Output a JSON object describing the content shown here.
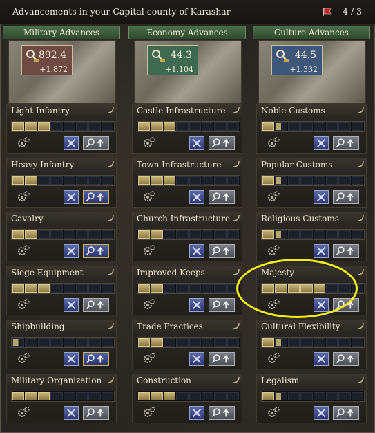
{
  "window": {
    "title": "Advancements in your Capital county of Karashar",
    "counter": "4 / 3"
  },
  "columns": [
    {
      "header": "Military Advances",
      "total": "892.4",
      "rate": "+1.872",
      "panel_color": "#6e4a45",
      "items": [
        {
          "name": "Light Infantry",
          "full": 3,
          "partial": 0
        },
        {
          "name": "Heavy Infantry",
          "full": 2,
          "partial": 0
        },
        {
          "name": "Cavalry",
          "full": 2,
          "partial": 0
        },
        {
          "name": "Siege Equipment",
          "full": 3,
          "partial": 0
        },
        {
          "name": "Shipbuilding",
          "full": 0,
          "partial": 1
        },
        {
          "name": "Military Organization",
          "full": 3,
          "partial": 0
        }
      ]
    },
    {
      "header": "Economy Advances",
      "total": "44.3",
      "rate": "+1.104",
      "panel_color": "#3f6a52",
      "items": [
        {
          "name": "Castle Infrastructure",
          "full": 3,
          "partial": 0
        },
        {
          "name": "Town Infrastructure",
          "full": 3,
          "partial": 0
        },
        {
          "name": "Church Infrastructure",
          "full": 2,
          "partial": 0
        },
        {
          "name": "Improved Keeps",
          "full": 2,
          "partial": 0
        },
        {
          "name": "Trade Practices",
          "full": 2,
          "partial": 0
        },
        {
          "name": "Construction",
          "full": 3,
          "partial": 0
        }
      ]
    },
    {
      "header": "Culture Advances",
      "total": "44.5",
      "rate": "+1.332",
      "panel_color": "#3d567a",
      "items": [
        {
          "name": "Noble Customs",
          "full": 1,
          "partial": 1
        },
        {
          "name": "Popular Customs",
          "full": 1,
          "partial": 1
        },
        {
          "name": "Religious Customs",
          "full": 1,
          "partial": 1
        },
        {
          "name": "Majesty",
          "full": 5,
          "partial": 0
        },
        {
          "name": "Cultural Flexibility",
          "full": 1,
          "partial": 1
        },
        {
          "name": "Legalism",
          "full": 1,
          "partial": 1
        }
      ]
    }
  ],
  "active_research": [
    {
      "column": 0,
      "item": 1
    },
    {
      "column": 0,
      "item": 2
    },
    {
      "column": 0,
      "item": 4
    }
  ],
  "highlight": {
    "column": 2,
    "item": 3,
    "color": "#f4ec13"
  }
}
